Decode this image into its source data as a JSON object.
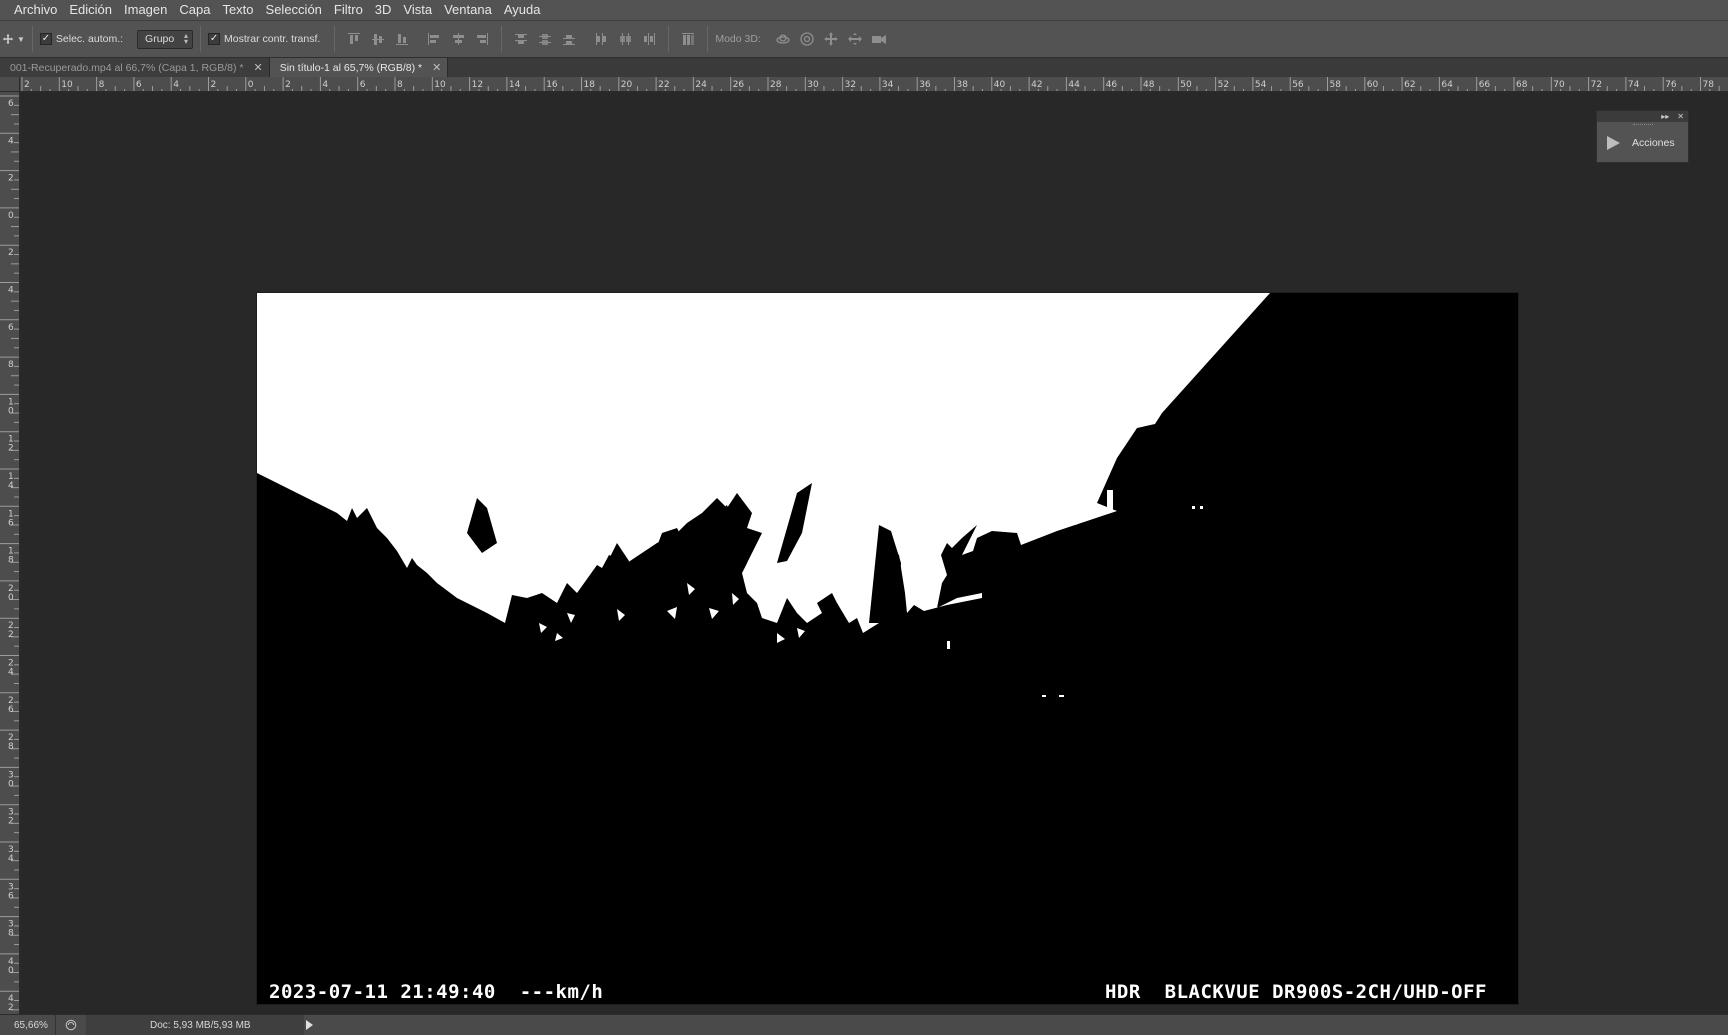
{
  "menu": [
    "Archivo",
    "Edición",
    "Imagen",
    "Capa",
    "Texto",
    "Selección",
    "Filtro",
    "3D",
    "Vista",
    "Ventana",
    "Ayuda"
  ],
  "options": {
    "auto_select_label": "Selec. autom.:",
    "auto_select_checked": true,
    "group_value": "Grupo",
    "show_transform_label": "Mostrar contr. transf.",
    "show_transform_checked": true,
    "mode_3d_label": "Modo 3D:"
  },
  "tabs": [
    {
      "label": "001-Recuperado.mp4 al 66,7% (Capa 1, RGB/8) *",
      "active": false
    },
    {
      "label": "Sin título-1 al 65,7% (RGB/8) *",
      "active": true
    }
  ],
  "ruler": {
    "top_labels": [
      "2",
      "10",
      "8",
      "6",
      "4",
      "2",
      "0",
      "2",
      "4",
      "6",
      "8",
      "10",
      "12",
      "14",
      "16",
      "18",
      "20",
      "22",
      "24",
      "26",
      "28",
      "30",
      "32",
      "34",
      "36",
      "38",
      "40",
      "42",
      "44",
      "46",
      "48",
      "50",
      "52",
      "54",
      "56",
      "58",
      "60",
      "62",
      "64",
      "66",
      "68",
      "70",
      "72",
      "74",
      "76",
      "78"
    ],
    "left_labels": [
      "6",
      "4",
      "2",
      "0",
      "2",
      "4",
      "6",
      "8",
      "10",
      "12",
      "14",
      "16",
      "18",
      "20",
      "22",
      "24",
      "26",
      "28",
      "30",
      "32",
      "34",
      "36",
      "38",
      "40",
      "42"
    ]
  },
  "canvas": {
    "overlay_left": "2023-07-11 21:49:40  ---km/h",
    "overlay_right": "HDR  BLACKVUE DR900S-2CH/UHD-OFF"
  },
  "panel": {
    "actions_label": "Acciones"
  },
  "status": {
    "zoom": "65,66%",
    "doc_info": "Doc: 5,93 MB/5,93 MB"
  },
  "colors": {
    "ui_bg": "#535353",
    "workspace": "#282828",
    "canvas_black": "#000000",
    "sky_white": "#ffffff"
  }
}
